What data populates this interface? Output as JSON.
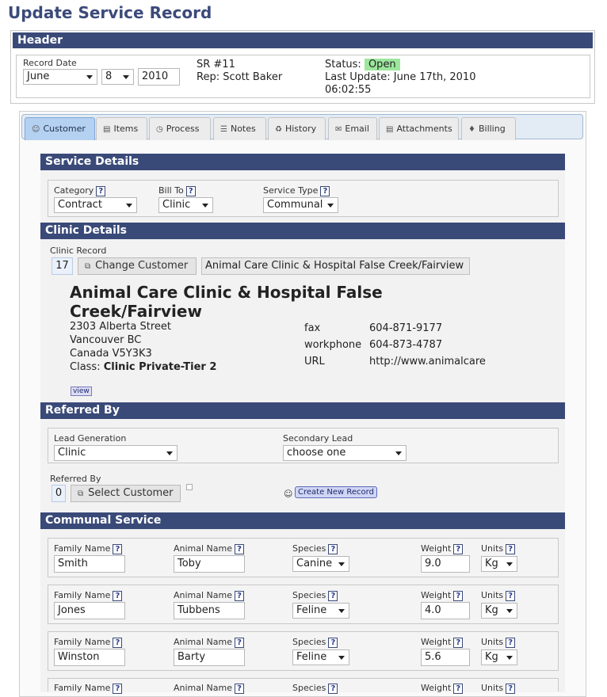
{
  "page": {
    "title": "Update Service Record"
  },
  "header": {
    "bar_title": "Header",
    "record_date_label": "Record Date",
    "month": "June",
    "day": "8",
    "year": "2010",
    "sr": "SR #11",
    "rep": "Rep: Scott Baker",
    "status_label": "Status:",
    "status_value": "Open",
    "last_update": "Last Update: June 17th, 2010",
    "last_update_time": "06:02:55"
  },
  "tabs": [
    {
      "label": "Customer",
      "icon": "person-icon"
    },
    {
      "label": "Items",
      "icon": "items-icon"
    },
    {
      "label": "Process",
      "icon": "clock-icon"
    },
    {
      "label": "Notes",
      "icon": "notes-icon"
    },
    {
      "label": "History",
      "icon": "history-icon"
    },
    {
      "label": "Email",
      "icon": "email-icon"
    },
    {
      "label": "Attachments",
      "icon": "attachments-icon"
    },
    {
      "label": "Billing",
      "icon": "tag-icon"
    }
  ],
  "service_details": {
    "title": "Service Details",
    "category_label": "Category",
    "category_value": "Contract",
    "bill_to_label": "Bill To",
    "bill_to_value": "Clinic",
    "service_type_label": "Service Type",
    "service_type_value": "Communal",
    "help": "?"
  },
  "clinic_details": {
    "title": "Clinic Details",
    "record_label": "Clinic Record",
    "record_id": "17",
    "change_button": "Change Customer",
    "record_name": "Animal Care Clinic & Hospital False Creek/Fairview",
    "name": "Animal Care Clinic & Hospital False Creek/Fairview",
    "address1": "2303 Alberta Street",
    "address2": "Vancouver BC",
    "address3": "Canada V5Y3K3",
    "class_label": "Class:",
    "class_value": "Clinic Private-Tier 2",
    "fax_label": "fax",
    "fax_value": "604-871-9177",
    "workphone_label": "workphone",
    "workphone_value": "604-873-4787",
    "url_label": "URL",
    "url_value": "http://www.animalcare",
    "view_button": "view"
  },
  "referred_by": {
    "title": "Referred By",
    "lead_generation_label": "Lead Generation",
    "lead_generation_value": "Clinic",
    "secondary_lead_label": "Secondary Lead",
    "secondary_lead_value": "choose one",
    "referred_by_label": "Referred By",
    "referred_by_id": "0",
    "select_customer_button": "Select Customer",
    "create_new_record_button": "Create New Record"
  },
  "communal_service": {
    "title": "Communal Service",
    "labels": {
      "family": "Family Name",
      "animal": "Animal Name",
      "species": "Species",
      "weight": "Weight",
      "units": "Units"
    },
    "rows": [
      {
        "family": "Smith",
        "animal": "Toby",
        "species": "Canine",
        "weight": "9.0",
        "units": "Kg"
      },
      {
        "family": "Jones",
        "animal": "Tubbens",
        "species": "Feline",
        "weight": "4.0",
        "units": "Kg"
      },
      {
        "family": "Winston",
        "animal": "Barty",
        "species": "Feline",
        "weight": "5.6",
        "units": "Kg"
      },
      {
        "family": "",
        "animal": "",
        "species": "",
        "weight": "",
        "units": ""
      }
    ]
  }
}
